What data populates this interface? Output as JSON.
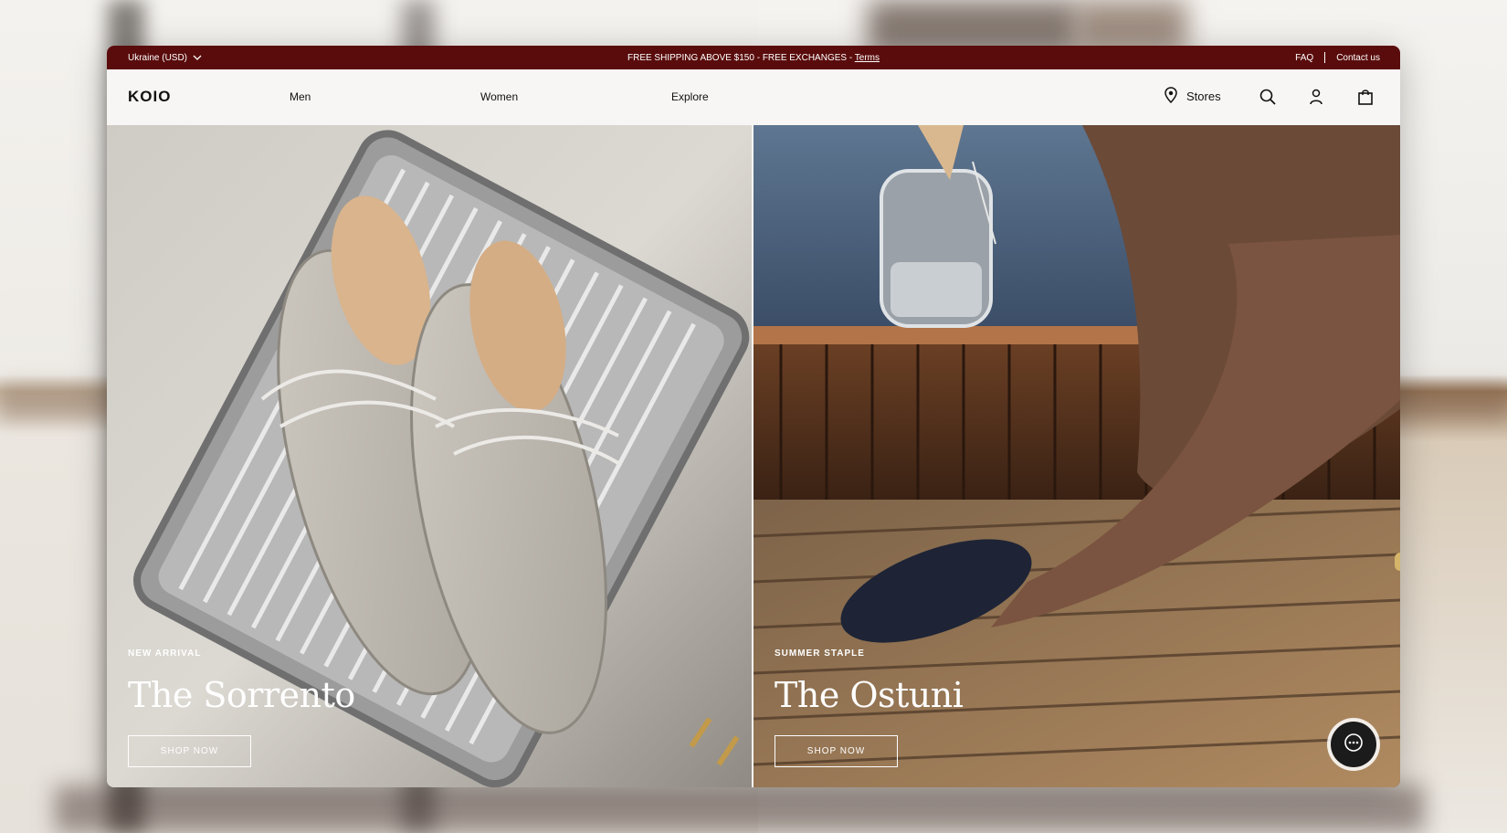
{
  "topbar": {
    "region": "Ukraine (USD)",
    "promo": "FREE SHIPPING ABOVE $150 - FREE EXCHANGES - ",
    "promo_link": "Terms",
    "faq": "FAQ",
    "contact": "Contact us"
  },
  "nav": {
    "logo": "KOIO",
    "men": "Men",
    "women": "Women",
    "explore": "Explore",
    "stores": "Stores"
  },
  "hero": {
    "left": {
      "eyebrow": "NEW ARRIVAL",
      "title": "The Sorrento",
      "cta": "SHOP NOW"
    },
    "right": {
      "eyebrow": "SUMMER STAPLE",
      "title": "The Ostuni",
      "cta": "SHOP NOW"
    }
  },
  "colors": {
    "topbar_bg": "#5a0c0c",
    "page_bg": "#f7f6f4"
  },
  "icons": [
    "chevron-down-icon",
    "location-pin-icon",
    "search-icon",
    "user-icon",
    "bag-icon",
    "chat-icon"
  ]
}
